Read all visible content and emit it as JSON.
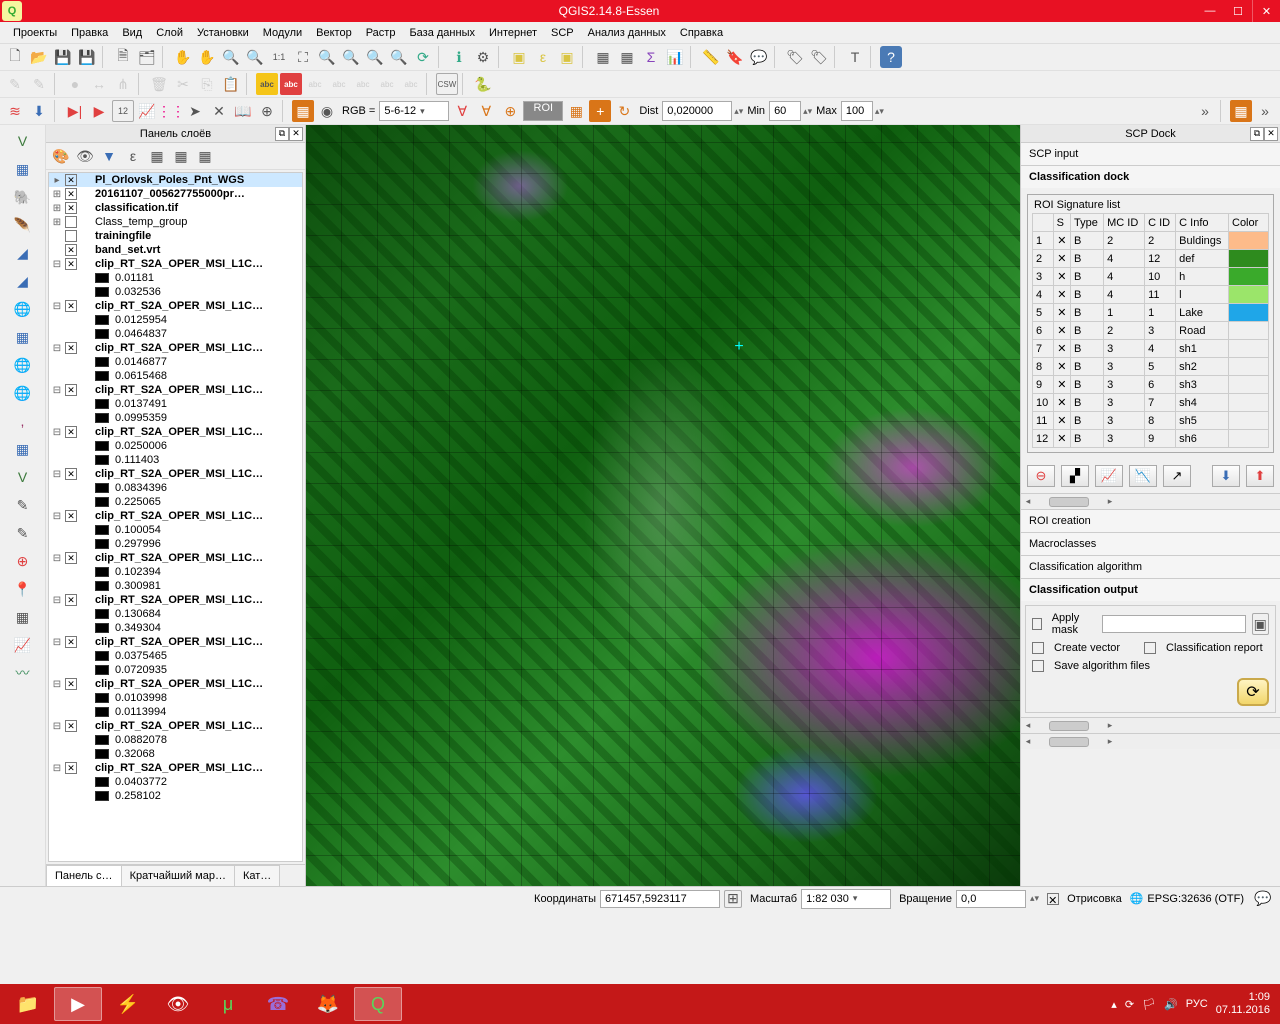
{
  "window": {
    "title": "QGIS2.14.8-Essen"
  },
  "menu": [
    "Проекты",
    "Правка",
    "Вид",
    "Слой",
    "Установки",
    "Модули",
    "Вектор",
    "Растр",
    "База данных",
    "Интернет",
    "SCP",
    "Анализ данных",
    "Справка"
  ],
  "toolbar3": {
    "rgb_label": "RGB =",
    "rgb_value": "5-6-12",
    "roi_label": "ROI",
    "dist_label": "Dist",
    "dist_value": "0,020000",
    "min_label": "Min",
    "min_value": "60",
    "max_label": "Max",
    "max_value": "100"
  },
  "layerspanel": {
    "title": "Панель слоёв",
    "tabs": [
      "Панель с…",
      "Кратчайший мар…",
      "Кат…"
    ],
    "items": [
      {
        "bold": true,
        "sel": true,
        "chk": true,
        "label": "Pl_Orlovsk_Poles_Pnt_WGS",
        "exp": "▸"
      },
      {
        "bold": true,
        "chk": true,
        "label": "20161107_005627755000pr…",
        "exp": "⊞"
      },
      {
        "bold": true,
        "chk": true,
        "label": "classification.tif",
        "exp": "⊞"
      },
      {
        "bold": false,
        "chk": false,
        "label": "Class_temp_group",
        "exp": "⊞"
      },
      {
        "bold": true,
        "chk": false,
        "label": "trainingfile",
        "exp": ""
      },
      {
        "bold": true,
        "chk": true,
        "label": "band_set.vrt",
        "exp": ""
      },
      {
        "bold": true,
        "chk": true,
        "label": "clip_RT_S2A_OPER_MSI_L1C…",
        "exp": "⊟",
        "children": [
          "0.01181",
          "0.032536"
        ]
      },
      {
        "bold": true,
        "chk": true,
        "label": "clip_RT_S2A_OPER_MSI_L1C…",
        "exp": "⊟",
        "children": [
          "0.0125954",
          "0.0464837"
        ]
      },
      {
        "bold": true,
        "chk": true,
        "label": "clip_RT_S2A_OPER_MSI_L1C…",
        "exp": "⊟",
        "children": [
          "0.0146877",
          "0.0615468"
        ]
      },
      {
        "bold": true,
        "chk": true,
        "label": "clip_RT_S2A_OPER_MSI_L1C…",
        "exp": "⊟",
        "children": [
          "0.0137491",
          "0.0995359"
        ]
      },
      {
        "bold": true,
        "chk": true,
        "label": "clip_RT_S2A_OPER_MSI_L1C…",
        "exp": "⊟",
        "children": [
          "0.0250006",
          "0.111403"
        ]
      },
      {
        "bold": true,
        "chk": true,
        "label": "clip_RT_S2A_OPER_MSI_L1C…",
        "exp": "⊟",
        "children": [
          "0.0834396",
          "0.225065"
        ]
      },
      {
        "bold": true,
        "chk": true,
        "label": "clip_RT_S2A_OPER_MSI_L1C…",
        "exp": "⊟",
        "children": [
          "0.100054",
          "0.297996"
        ]
      },
      {
        "bold": true,
        "chk": true,
        "label": "clip_RT_S2A_OPER_MSI_L1C…",
        "exp": "⊟",
        "children": [
          "0.102394",
          "0.300981"
        ]
      },
      {
        "bold": true,
        "chk": true,
        "label": "clip_RT_S2A_OPER_MSI_L1C…",
        "exp": "⊟",
        "children": [
          "0.130684",
          "0.349304"
        ]
      },
      {
        "bold": true,
        "chk": true,
        "label": "clip_RT_S2A_OPER_MSI_L1C…",
        "exp": "⊟",
        "children": [
          "0.0375465",
          "0.0720935"
        ]
      },
      {
        "bold": true,
        "chk": true,
        "label": "clip_RT_S2A_OPER_MSI_L1C…",
        "exp": "⊟",
        "children": [
          "0.0103998",
          "0.0113994"
        ]
      },
      {
        "bold": true,
        "chk": true,
        "label": "clip_RT_S2A_OPER_MSI_L1C…",
        "exp": "⊟",
        "children": [
          "0.0882078",
          "0.32068"
        ]
      },
      {
        "bold": true,
        "chk": true,
        "label": "clip_RT_S2A_OPER_MSI_L1C…",
        "exp": "⊟",
        "children": [
          "0.0403772",
          "0.258102"
        ]
      }
    ]
  },
  "scp": {
    "dock_title": "SCP Dock",
    "input": "SCP input",
    "classdock": "Classification dock",
    "roilist": "ROI Signature list",
    "headers": [
      "",
      "S",
      "Type",
      "MC ID",
      "C ID",
      "C Info",
      "Color"
    ],
    "rows": [
      {
        "n": "1",
        "s": true,
        "type": "B",
        "mc": "2",
        "c": "2",
        "info": "Buldings",
        "color": "#fdbb8a"
      },
      {
        "n": "2",
        "s": true,
        "type": "B",
        "mc": "4",
        "c": "12",
        "info": "def",
        "color": "#2e8b1e"
      },
      {
        "n": "3",
        "s": true,
        "type": "B",
        "mc": "4",
        "c": "10",
        "info": "h",
        "color": "#3aaa2b"
      },
      {
        "n": "4",
        "s": true,
        "type": "B",
        "mc": "4",
        "c": "11",
        "info": "l",
        "color": "#9be56a"
      },
      {
        "n": "5",
        "s": true,
        "type": "B",
        "mc": "1",
        "c": "1",
        "info": "Lake",
        "color": "#1fa6e8"
      },
      {
        "n": "6",
        "s": true,
        "type": "B",
        "mc": "2",
        "c": "3",
        "info": "Road",
        "color": ""
      },
      {
        "n": "7",
        "s": true,
        "type": "B",
        "mc": "3",
        "c": "4",
        "info": "sh1",
        "color": ""
      },
      {
        "n": "8",
        "s": true,
        "type": "B",
        "mc": "3",
        "c": "5",
        "info": "sh2",
        "color": ""
      },
      {
        "n": "9",
        "s": true,
        "type": "B",
        "mc": "3",
        "c": "6",
        "info": "sh3",
        "color": ""
      },
      {
        "n": "10",
        "s": true,
        "type": "B",
        "mc": "3",
        "c": "7",
        "info": "sh4",
        "color": ""
      },
      {
        "n": "11",
        "s": true,
        "type": "B",
        "mc": "3",
        "c": "8",
        "info": "sh5",
        "color": ""
      },
      {
        "n": "12",
        "s": true,
        "type": "B",
        "mc": "3",
        "c": "9",
        "info": "sh6",
        "color": ""
      }
    ],
    "roi_creation": "ROI creation",
    "macroclasses": "Macroclasses",
    "class_algo": "Classification algorithm",
    "class_output": "Classification output",
    "apply_mask": "Apply mask",
    "create_vector": "Create vector",
    "class_report": "Classification report",
    "save_algo": "Save algorithm files"
  },
  "status": {
    "coord_label": "Координаты",
    "coord_value": "671457,5923117",
    "scale_label": "Масштаб",
    "scale_value": "1:82 030",
    "rot_label": "Вращение",
    "rot_value": "0,0",
    "render": "Отрисовка",
    "crs": "EPSG:32636 (OTF)"
  },
  "taskbar": {
    "lang": "РУС",
    "time": "1:09",
    "date": "07.11.2016"
  }
}
